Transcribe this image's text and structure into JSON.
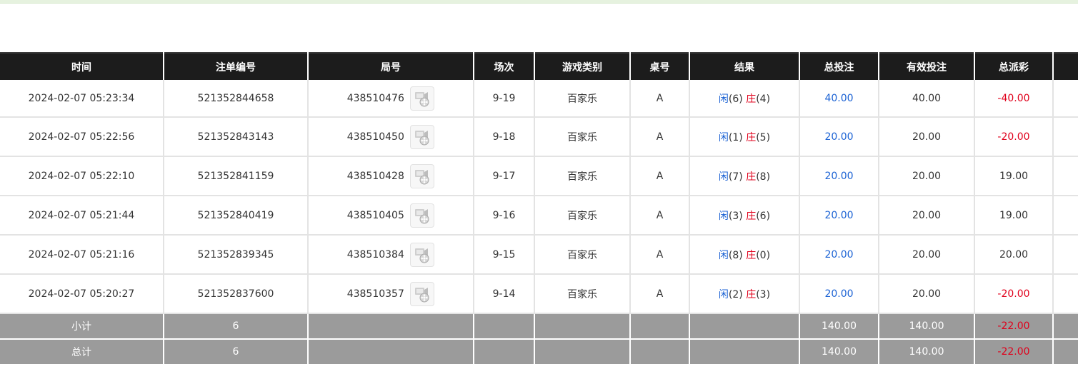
{
  "headers": [
    "时间",
    "注单编号",
    "局号",
    "场次",
    "游戏类别",
    "桌号",
    "结果",
    "总投注",
    "有效投注",
    "总派彩"
  ],
  "rows": [
    {
      "time": "2024-02-07 05:23:34",
      "bet_id": "521352844658",
      "round": "438510476",
      "shoe": "9-19",
      "game": "百家乐",
      "table": "A",
      "player_label": "闲",
      "player_score": "(6)",
      "banker_label": "庄",
      "banker_score": "(4)",
      "total_bet": "40.00",
      "valid_bet": "40.00",
      "payout": "-40.00",
      "payout_negative": true
    },
    {
      "time": "2024-02-07 05:22:56",
      "bet_id": "521352843143",
      "round": "438510450",
      "shoe": "9-18",
      "game": "百家乐",
      "table": "A",
      "player_label": "闲",
      "player_score": "(1)",
      "banker_label": "庄",
      "banker_score": "(5)",
      "total_bet": "20.00",
      "valid_bet": "20.00",
      "payout": "-20.00",
      "payout_negative": true
    },
    {
      "time": "2024-02-07 05:22:10",
      "bet_id": "521352841159",
      "round": "438510428",
      "shoe": "9-17",
      "game": "百家乐",
      "table": "A",
      "player_label": "闲",
      "player_score": "(7)",
      "banker_label": "庄",
      "banker_score": "(8)",
      "total_bet": "20.00",
      "valid_bet": "20.00",
      "payout": "19.00",
      "payout_negative": false
    },
    {
      "time": "2024-02-07 05:21:44",
      "bet_id": "521352840419",
      "round": "438510405",
      "shoe": "9-16",
      "game": "百家乐",
      "table": "A",
      "player_label": "闲",
      "player_score": "(3)",
      "banker_label": "庄",
      "banker_score": "(6)",
      "total_bet": "20.00",
      "valid_bet": "20.00",
      "payout": "19.00",
      "payout_negative": false
    },
    {
      "time": "2024-02-07 05:21:16",
      "bet_id": "521352839345",
      "round": "438510384",
      "shoe": "9-15",
      "game": "百家乐",
      "table": "A",
      "player_label": "闲",
      "player_score": "(8)",
      "banker_label": "庄",
      "banker_score": "(0)",
      "total_bet": "20.00",
      "valid_bet": "20.00",
      "payout": "20.00",
      "payout_negative": false
    },
    {
      "time": "2024-02-07 05:20:27",
      "bet_id": "521352837600",
      "round": "438510357",
      "shoe": "9-14",
      "game": "百家乐",
      "table": "A",
      "player_label": "闲",
      "player_score": "(2)",
      "banker_label": "庄",
      "banker_score": "(3)",
      "total_bet": "20.00",
      "valid_bet": "20.00",
      "payout": "-20.00",
      "payout_negative": true
    }
  ],
  "subtotal": {
    "label": "小计",
    "count": "6",
    "total_bet": "140.00",
    "valid_bet": "140.00",
    "payout": "-22.00"
  },
  "grand_total": {
    "label": "总计",
    "count": "6",
    "total_bet": "140.00",
    "valid_bet": "140.00",
    "payout": "-22.00"
  },
  "icons": {
    "replay": "video-replay-icon"
  },
  "colors": {
    "header_bg": "#1c1c1c",
    "footer_bg": "#9b9b9b",
    "blue": "#1b62d4",
    "red": "#e0001b"
  }
}
